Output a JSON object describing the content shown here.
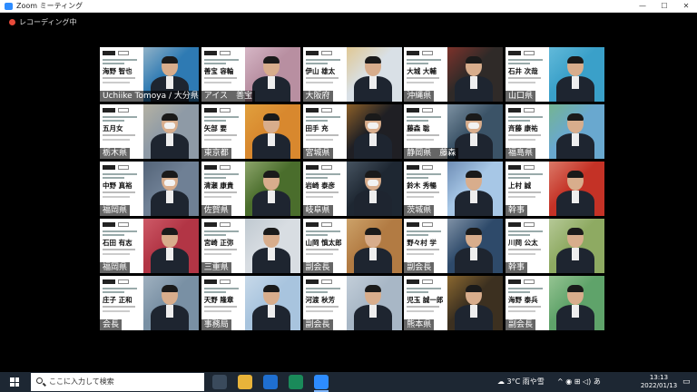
{
  "window": {
    "title": "Zoom ミーティング",
    "minimize": "—",
    "maximize": "☐",
    "close": "✕"
  },
  "recording": {
    "label": "レコーディング中"
  },
  "tiles": [
    {
      "name": "海野 智也",
      "label": "Uchiike Tomoya / 大分県",
      "pref": "",
      "bg": "#2e7ab3",
      "accent": "#e9e4da",
      "card": true,
      "active": true
    },
    {
      "name": "善宝 容輪",
      "label": "アイス　善宝",
      "bg": "#b88fa1",
      "accent": "#f0d9e6",
      "card": true
    },
    {
      "name": "伊山 雄太",
      "label": "大阪府",
      "bg": "#d9e0e6",
      "accent": "#e6b24a",
      "card": true
    },
    {
      "name": "大城 大輔",
      "label": "沖縄県",
      "bg": "#2f2a28",
      "accent": "#c33a2d",
      "card": true
    },
    {
      "name": "石井 次哉",
      "label": "山口県",
      "bg": "#3aa0c9",
      "accent": "#85d0e8",
      "card": true
    },
    {
      "name": "五月女",
      "label": "栃木県",
      "bg": "#8e9aa6",
      "accent": "#d7c7a0",
      "card": true
    },
    {
      "name": "矢部 要",
      "label": "東京都",
      "bg": "#d8882e",
      "accent": "#e8b54b",
      "card": true
    },
    {
      "name": "田手 充",
      "label": "宮城県",
      "bg": "#1f1f24",
      "accent": "#f09a2c",
      "card": true
    },
    {
      "name": "藤森 聡",
      "label": "静岡県　藤森",
      "bg": "#3b5367",
      "accent": "#b7c8d6",
      "card": true
    },
    {
      "name": "斉藤 康祐",
      "label": "福島県",
      "bg": "#69a8cf",
      "accent": "#7fbf5a",
      "card": true
    },
    {
      "name": "中野 真裕",
      "label": "福岡県",
      "bg": "#6f8095",
      "accent": "#3b4a5e",
      "card": true
    },
    {
      "name": "清瀬 康貴",
      "label": "佐賀県",
      "bg": "#4a6d2c",
      "accent": "#c9d7a3",
      "card": true
    },
    {
      "name": "岩崎 泰彦",
      "label": "岐阜県",
      "bg": "#1e2732",
      "accent": "#6a7b8a",
      "card": true
    },
    {
      "name": "鈴木 秀暢",
      "label": "茨城県",
      "bg": "#a7c7e6",
      "accent": "#3c5a8a",
      "card": true
    },
    {
      "name": "上村 誠",
      "label": "幹事",
      "bg": "#c43226",
      "accent": "#f0b7a1",
      "card": true
    },
    {
      "name": "石田 有志",
      "label": "福岡県",
      "bg": "#b23545",
      "accent": "#e67b86",
      "card": true
    },
    {
      "name": "宮崎 正弥",
      "label": "三重県",
      "bg": "#d8dde2",
      "accent": "#a9b6c0",
      "card": true
    },
    {
      "name": "山岡 慎太郎",
      "label": "副会長",
      "bg": "#b27b43",
      "accent": "#e4c58c",
      "card": true
    },
    {
      "name": "野々村 学",
      "label": "副会長",
      "bg": "#2e4a6a",
      "accent": "#c9d2dc",
      "card": true
    },
    {
      "name": "川岡 公太",
      "label": "幹事",
      "bg": "#8eaa62",
      "accent": "#d9e4c6",
      "card": true
    },
    {
      "name": "庄子 正和",
      "label": "会長",
      "bg": "#7990a4",
      "accent": "#c2ced8",
      "card": true
    },
    {
      "name": "天野 隆章",
      "label": "事務局",
      "bg": "#a8c4de",
      "accent": "#e4ecf3",
      "card": true
    },
    {
      "name": "河渡 秋芳",
      "label": "副会長",
      "bg": "#a8b7c6",
      "accent": "#dbe3ea",
      "card": true
    },
    {
      "name": "児玉 誠一郎",
      "label": "熊本県",
      "bg": "#3c3020",
      "accent": "#d19a3e",
      "card": true
    },
    {
      "name": "海野 泰兵",
      "label": "副会長",
      "bg": "#5fa36a",
      "accent": "#c6e1b5",
      "card": true
    }
  ],
  "taskbar": {
    "search_placeholder": "ここに入力して検索",
    "weather": "3°C  雨や雪",
    "tray_icons": "^  ◉  ⊞  ◁)  あ",
    "time": "13:13",
    "date": "2022/01/13"
  },
  "colors": {
    "active_speaker": "#b9d21e",
    "taskbar": "#1d2733",
    "recording_dot": "#e84a3a"
  }
}
